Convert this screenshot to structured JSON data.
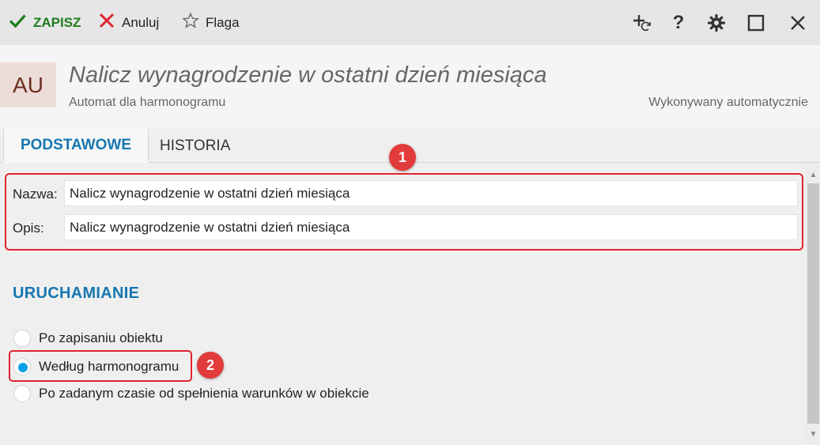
{
  "toolbar": {
    "save_label": "ZAPISZ",
    "cancel_label": "Anuluj",
    "flag_label": "Flaga",
    "icons": [
      "add-refresh-icon",
      "help-icon",
      "gear-icon",
      "maximize-icon",
      "close-icon"
    ],
    "help_glyph": "?"
  },
  "header": {
    "avatar_text": "AU",
    "title": "Nalicz wynagrodzenie w ostatni dzień miesiąca",
    "subtitle": "Automat dla harmonogramu",
    "status": "Wykonywany automatycznie"
  },
  "tabs": [
    {
      "label": "PODSTAWOWE",
      "active": true
    },
    {
      "label": "HISTORIA",
      "active": false
    }
  ],
  "form": {
    "name_label": "Nazwa:",
    "name_value": "Nalicz wynagrodzenie w ostatni dzień miesiąca",
    "desc_label": "Opis:",
    "desc_value": "Nalicz wynagrodzenie w ostatni dzień miesiąca"
  },
  "section": {
    "title": "URUCHAMIANIE",
    "options": [
      {
        "label": "Po zapisaniu obiektu",
        "checked": false
      },
      {
        "label": "Według harmonogramu",
        "checked": true
      },
      {
        "label": "Po zadanym czasie od spełnienia warunków w obiekcie",
        "checked": false
      }
    ]
  },
  "annotations": [
    "1",
    "2"
  ],
  "colors": {
    "accent": "#1677b0",
    "save_green": "#1e7d1e",
    "cancel_red": "#e0242f",
    "radio_selected": "#0aa0e6",
    "annotation_red": "#e23b3b"
  }
}
